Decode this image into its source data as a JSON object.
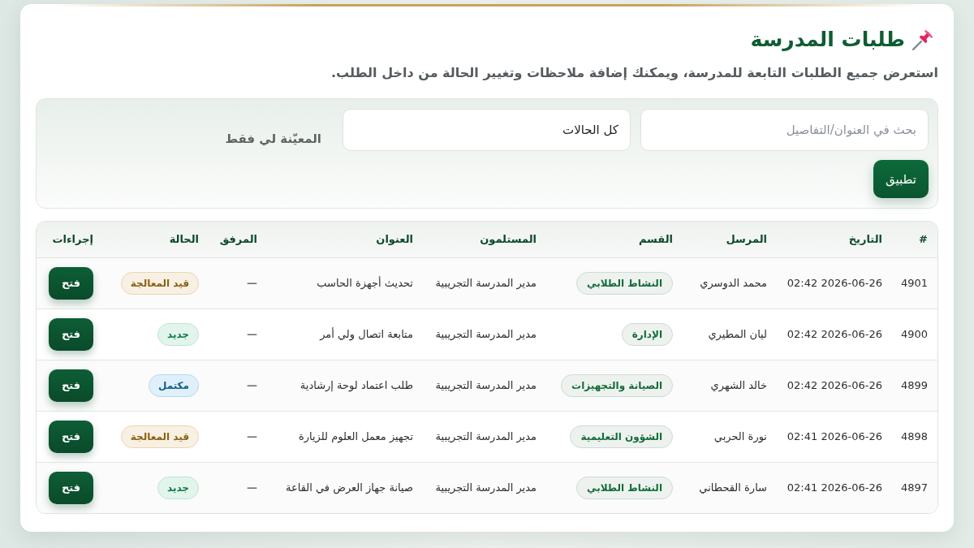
{
  "header": {
    "title": "طلبات المدرسة",
    "subtitle": "استعرض جميع الطلبات التابعة للمدرسة، ويمكنك إضافة ملاحظات وتغيير الحالة من داخل الطلب."
  },
  "filters": {
    "search": {
      "placeholder": "بحث في العنوان/التفاصيل"
    },
    "status_select": {
      "value": "كل الحالات"
    },
    "assigned_label": "المعيّنة لي فقط",
    "apply_button": "تطبيق"
  },
  "table": {
    "columns": [
      "#",
      "التاريخ",
      "المرسل",
      "القسم",
      "المستلمون",
      "العنوان",
      "المرفق",
      "الحالة",
      "إجراءات"
    ],
    "rows": [
      {
        "id": "4901",
        "date": "2026-06-26 02:42",
        "sender": "محمد الدوسري",
        "department": "النشاط الطلابي",
        "recipients": "مدير المدرسة التجريبية",
        "title": "تحديث أجهزة الحاسب",
        "attachment": "—",
        "status": {
          "label": "قيد المعالجة",
          "kind": "processing"
        },
        "action": "فتح"
      },
      {
        "id": "4900",
        "date": "2026-06-26 02:42",
        "sender": "ليان المطيري",
        "department": "الإدارة",
        "recipients": "مدير المدرسة التجريبية",
        "title": "متابعة اتصال ولي أمر",
        "attachment": "—",
        "status": {
          "label": "جديد",
          "kind": "new"
        },
        "action": "فتح"
      },
      {
        "id": "4899",
        "date": "2026-06-26 02:42",
        "sender": "خالد الشهري",
        "department": "الصيانة والتجهيزات",
        "recipients": "مدير المدرسة التجريبية",
        "title": "طلب اعتماد لوحة إرشادية",
        "attachment": "—",
        "status": {
          "label": "مكتمل",
          "kind": "done"
        },
        "action": "فتح"
      },
      {
        "id": "4898",
        "date": "2026-06-26 02:41",
        "sender": "نورة الحربي",
        "department": "الشؤون التعليمية",
        "recipients": "مدير المدرسة التجريبية",
        "title": "تجهيز معمل العلوم للزيارة",
        "attachment": "—",
        "status": {
          "label": "قيد المعالجة",
          "kind": "processing"
        },
        "action": "فتح"
      },
      {
        "id": "4897",
        "date": "2026-06-26 02:41",
        "sender": "سارة القحطاني",
        "department": "النشاط الطلابي",
        "recipients": "مدير المدرسة التجريبية",
        "title": "صيانة جهاز العرض في القاعة",
        "attachment": "—",
        "status": {
          "label": "جديد",
          "kind": "new"
        },
        "action": "فتح"
      }
    ]
  }
}
